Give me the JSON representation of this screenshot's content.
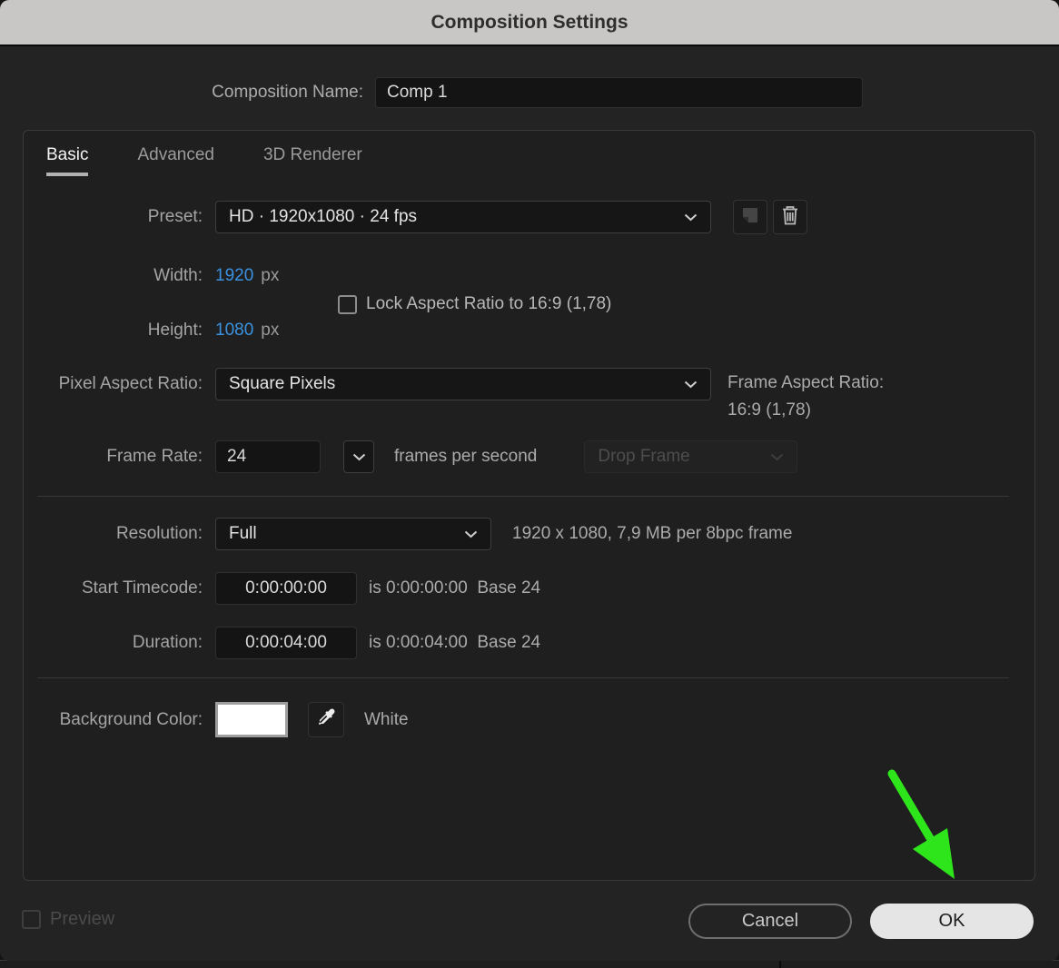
{
  "window": {
    "title": "Composition Settings"
  },
  "composition_name": {
    "label": "Composition Name:",
    "value": "Comp 1"
  },
  "tabs": [
    {
      "label": "Basic",
      "active": true
    },
    {
      "label": "Advanced",
      "active": false
    },
    {
      "label": "3D Renderer",
      "active": false
    }
  ],
  "basic": {
    "preset": {
      "label": "Preset:",
      "value": "HD · 1920x1080 · 24 fps"
    },
    "width": {
      "label": "Width:",
      "value": "1920",
      "unit": "px"
    },
    "height": {
      "label": "Height:",
      "value": "1080",
      "unit": "px"
    },
    "lock_aspect": {
      "label": "Lock Aspect Ratio to 16:9 (1,78)",
      "checked": false
    },
    "pixel_aspect_ratio": {
      "label": "Pixel Aspect Ratio:",
      "value": "Square Pixels"
    },
    "frame_aspect_ratio": {
      "label": "Frame Aspect Ratio:",
      "value": "16:9 (1,78)"
    },
    "frame_rate": {
      "label": "Frame Rate:",
      "value": "24",
      "suffix": "frames per second",
      "drop_frame": "Drop Frame"
    },
    "resolution": {
      "label": "Resolution:",
      "value": "Full",
      "info": "1920 x 1080, 7,9 MB per 8bpc frame"
    },
    "start_timecode": {
      "label": "Start Timecode:",
      "value": "0:00:00:00",
      "info": "is 0:00:00:00  Base 24"
    },
    "duration": {
      "label": "Duration:",
      "value": "0:00:04:00",
      "info": "is 0:00:04:00  Base 24"
    },
    "background_color": {
      "label": "Background Color:",
      "value": "White",
      "swatch_color": "#ffffff"
    }
  },
  "footer": {
    "preview_label": "Preview",
    "cancel_label": "Cancel",
    "ok_label": "OK"
  },
  "icons": {
    "preset_dropdown": "chevron-down-icon",
    "preset_save": "new-preset-icon",
    "preset_delete": "trash-icon",
    "frame_rate_dropdown": "chevron-down-icon",
    "background_eyedropper": "eyedropper-icon",
    "annotation": "green-arrow"
  },
  "colors": {
    "titlebar_bg": "#c8c7c5",
    "accent_blue": "#3b92e0",
    "arrow_green": "#2ee51b",
    "dialog_bg": "#232323"
  }
}
